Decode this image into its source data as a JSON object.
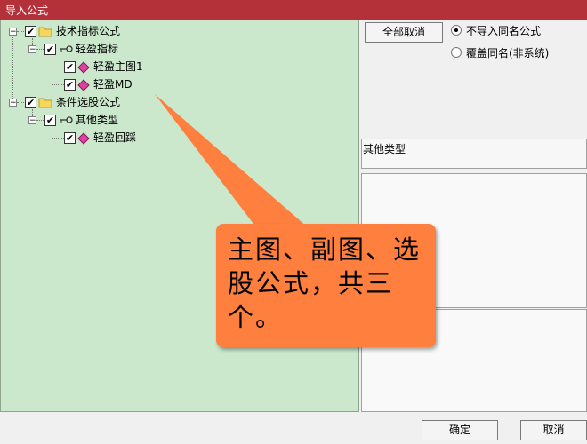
{
  "window": {
    "title": "导入公式"
  },
  "tree": {
    "groups": [
      {
        "label": "技术指标公式",
        "checked": true,
        "expanded": true,
        "children": [
          {
            "label": "轻盈指标",
            "checked": true,
            "expanded": true,
            "children": [
              {
                "label": "轻盈主图1",
                "checked": true
              },
              {
                "label": "轻盈MD",
                "checked": true
              }
            ]
          }
        ]
      },
      {
        "label": "条件选股公式",
        "checked": true,
        "expanded": true,
        "children": [
          {
            "label": "其他类型",
            "checked": true,
            "expanded": true,
            "children": [
              {
                "label": "轻盈回踩",
                "checked": true
              }
            ]
          }
        ]
      }
    ],
    "expander_symbol": "−",
    "check_symbol": "✔"
  },
  "controls": {
    "deselect_all_label": "全部取消",
    "options": [
      {
        "label": "不导入同名公式",
        "selected": true
      },
      {
        "label": "覆盖同名(非系统)",
        "selected": false
      }
    ],
    "category_label": "其他类型",
    "ok_label": "确定",
    "cancel_label": "取消"
  },
  "annotation": {
    "text": "主图、副图、选股公式，共三个。",
    "color": "#ff7f3e"
  },
  "icons": {
    "folder": "folder-icon",
    "key": "key-icon",
    "formula": "diamond-icon"
  }
}
